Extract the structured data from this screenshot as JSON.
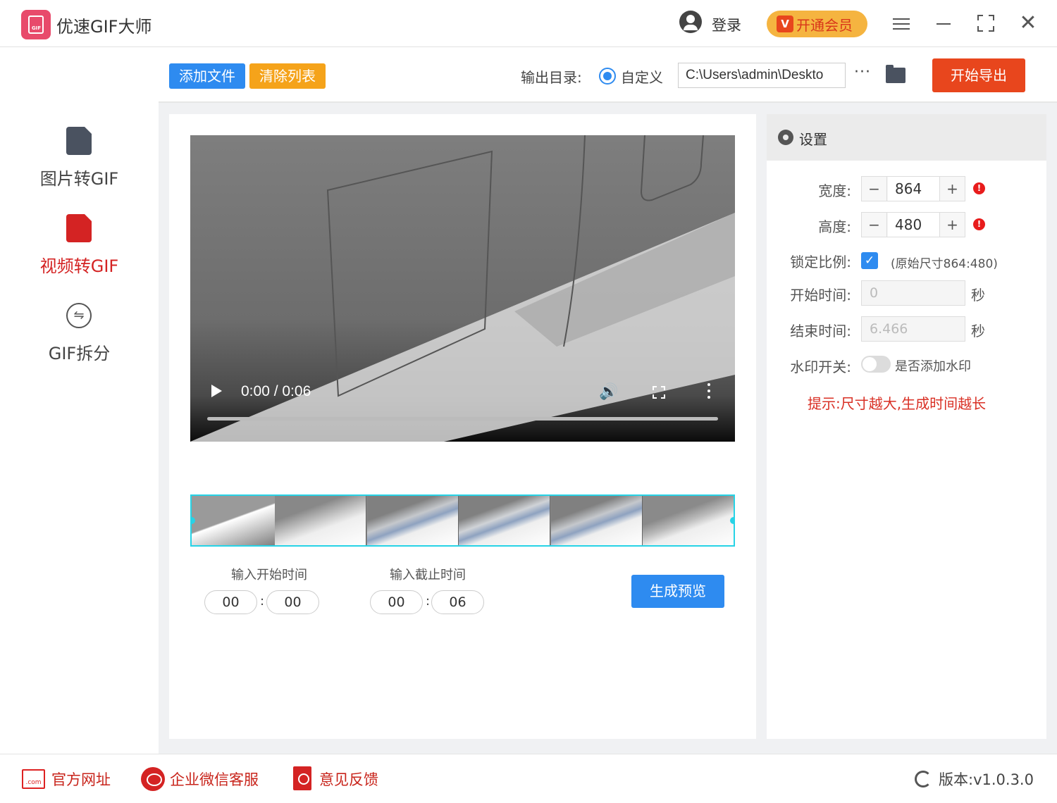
{
  "app": {
    "title": "优速GIF大师",
    "logo_text": "GIF"
  },
  "header": {
    "login": "登录",
    "vip_badge": "V",
    "vip": "开通会员"
  },
  "sidebar": {
    "items": [
      {
        "label": "图片转GIF",
        "icon": "image-file-icon",
        "active": false
      },
      {
        "label": "视频转GIF",
        "icon": "video-file-icon",
        "active": true
      },
      {
        "label": "GIF拆分",
        "icon": "split-icon",
        "active": false
      }
    ],
    "split_glyph": "⇋"
  },
  "toolbar": {
    "add_files": "添加文件",
    "clear_list": "清除列表",
    "output_label": "输出目录:",
    "custom_option": "自定义",
    "output_path": "C:\\Users\\admin\\Deskto",
    "more": "···",
    "start_export": "开始导出"
  },
  "video": {
    "time": "0:00 / 0:06",
    "volume_glyph": "🔊"
  },
  "trim": {
    "start_label": "输入开始时间",
    "end_label": "输入截止时间",
    "start_min": "00",
    "start_sec": "00",
    "end_min": "00",
    "end_sec": "06",
    "separator": ":",
    "preview_button": "生成预览"
  },
  "settings": {
    "title": "设置",
    "width_label": "宽度:",
    "width": "864",
    "height_label": "高度:",
    "height": "480",
    "minus": "−",
    "plus": "+",
    "warn": "!",
    "lock_label": "锁定比例:",
    "lock_checked": "✓",
    "original_size": "(原始尺寸864:480)",
    "start_time_label": "开始时间:",
    "start_time": "0",
    "end_time_label": "结束时间:",
    "end_time": "6.466",
    "seconds_unit": "秒",
    "watermark_label": "水印开关:",
    "watermark_toggle_label": "是否添加水印",
    "hint": "提示:尺寸越大,生成时间越长"
  },
  "footer": {
    "website": "官方网址",
    "website_icon_text": ".com",
    "wechat_service": "企业微信客服",
    "feedback": "意见反馈",
    "version": "版本:v1.0.3.0"
  },
  "colors": {
    "primary": "#2e8bf0",
    "orange": "#f5a31a",
    "export_red": "#e8461d",
    "active_red": "#d42323",
    "strip_cyan": "#27d3e6"
  }
}
